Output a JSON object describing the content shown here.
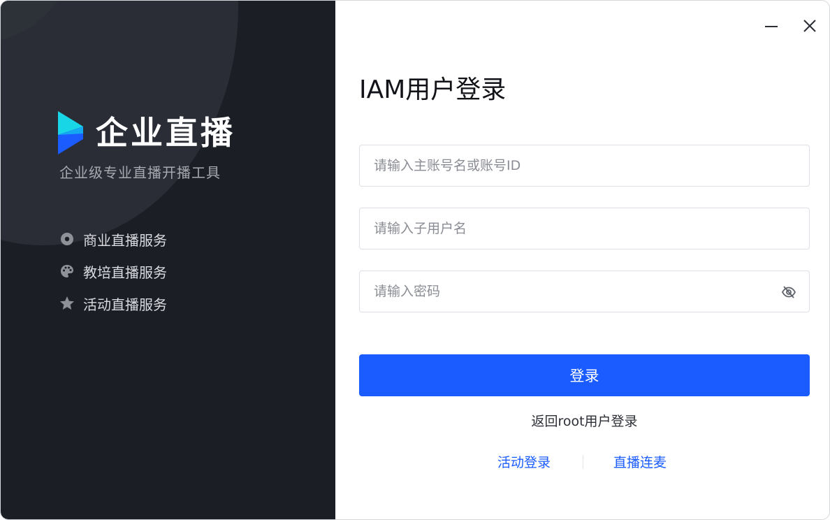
{
  "brand": {
    "name": "企业直播",
    "tagline": "企业级专业直播开播工具",
    "logo_icon": "play-triangle-logo-icon"
  },
  "features": [
    {
      "label": "商业直播服务",
      "icon": "disc-icon"
    },
    {
      "label": "教培直播服务",
      "icon": "palette-icon"
    },
    {
      "label": "活动直播服务",
      "icon": "star-icon"
    }
  ],
  "window": {
    "minimize_icon": "minimize-icon",
    "close_icon": "close-icon"
  },
  "login": {
    "title": "IAM用户登录",
    "account_placeholder": "请输入主账号名或账号ID",
    "username_placeholder": "请输入子用户名",
    "password_placeholder": "请输入密码",
    "password_toggle_icon": "eye-off-icon",
    "submit_label": "登录",
    "back_link": "返回root用户登录",
    "activity_login": "活动登录",
    "live_cohost": "直播连麦"
  },
  "colors": {
    "left_bg": "#1b1e25",
    "accent": "#1a5cff",
    "logo_cyan": "#19d6e6",
    "logo_blue": "#1a5cff"
  }
}
